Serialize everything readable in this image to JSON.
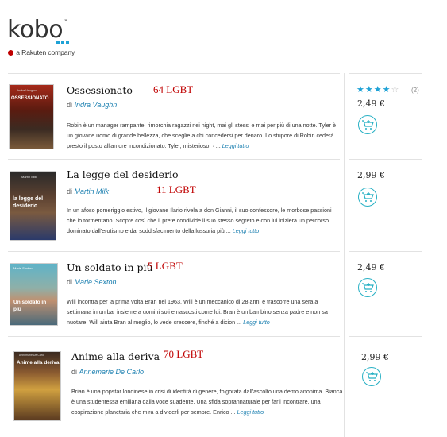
{
  "brand": {
    "name": "kobo",
    "trademark": "™",
    "tagline": "a Rakuten company"
  },
  "books": [
    {
      "title": "Ossessionato",
      "note": "64 LGBT",
      "by": "di",
      "author": "Indra Vaughn",
      "cover_text": "OSSESSIONATO",
      "cover_author": "Indra Vaughn",
      "description": "Robin è un manager rampante, rimorchia ragazzi nei night, mai gli stessi e mai per più di una notte. Tyler è un giovane uomo di grande bellezza, che sceglie a chi concedersi per denaro. Lo stupore di Robin cederà presto il posto all'amore incondizionato. Tyler, misterioso, · ...",
      "read_more": "Leggi tutto",
      "rating": 4,
      "rating_max": 5,
      "rating_count": "(2)",
      "price": "2,49 €"
    },
    {
      "title": "La legge del desiderio",
      "note": "11 LGBT",
      "by": "di",
      "author": "Martin Milk",
      "cover_text": "la legge del desiderio",
      "cover_author": "Martin Milk",
      "description": "In un afoso pomeriggio estivo, il giovane Ilario rivela a don Gianni, il suo confessore, le morbose passioni che lo tormentano. Scopre così che il prete condivide il suo stesso segreto e con lui inizierà un percorso dominato dall'erotismo e dal soddisfacimento della lussuria più ...",
      "read_more": "Leggi tutto",
      "price": "2,99 €"
    },
    {
      "title": "Un soldato in più",
      "note": "5 LGBT",
      "by": "di",
      "author": "Marie Sexton",
      "cover_text": "Un soldato in più",
      "cover_author": "Marie Sexton",
      "description": "Will incontra per la prima volta Bran nel 1963. Will è un meccanico di 28 anni e trascorre una sera a settimana in un bar insieme a uomini soli e nascosti come lui. Bran è un bambino senza padre e non sa nuotare. Will aiuta Bran al meglio, lo vede crescere, finché a dicion ...",
      "read_more": "Leggi tutto",
      "price": "2,49 €"
    },
    {
      "title": "Anime alla deriva",
      "note": "70 LGBT",
      "by": "di",
      "author": "Annemarie De Carlo",
      "cover_text": "Anime alla deriva",
      "cover_author": "Annemarie De Carlo",
      "description": "Brian è una popstar londinese in crisi di identità di genere, folgorata dall'ascolto una demo anonima. Bianca è una studentessa emiliana dalla voce suadente. Una sfida soprannaturale per farli incontrare, una cospirazione planetaria che mira a dividerli per sempre. Enrico ...",
      "read_more": "Leggi tutto",
      "price": "2,99 €"
    }
  ],
  "icons": {
    "cart": "add-to-cart-icon",
    "star": "star-icon"
  },
  "colors": {
    "accent": "#1fa2d6",
    "cart": "#27b0c4",
    "note": "#c00000",
    "logo_dots": "#1fa2d6",
    "rakuten": "#bf0000"
  }
}
